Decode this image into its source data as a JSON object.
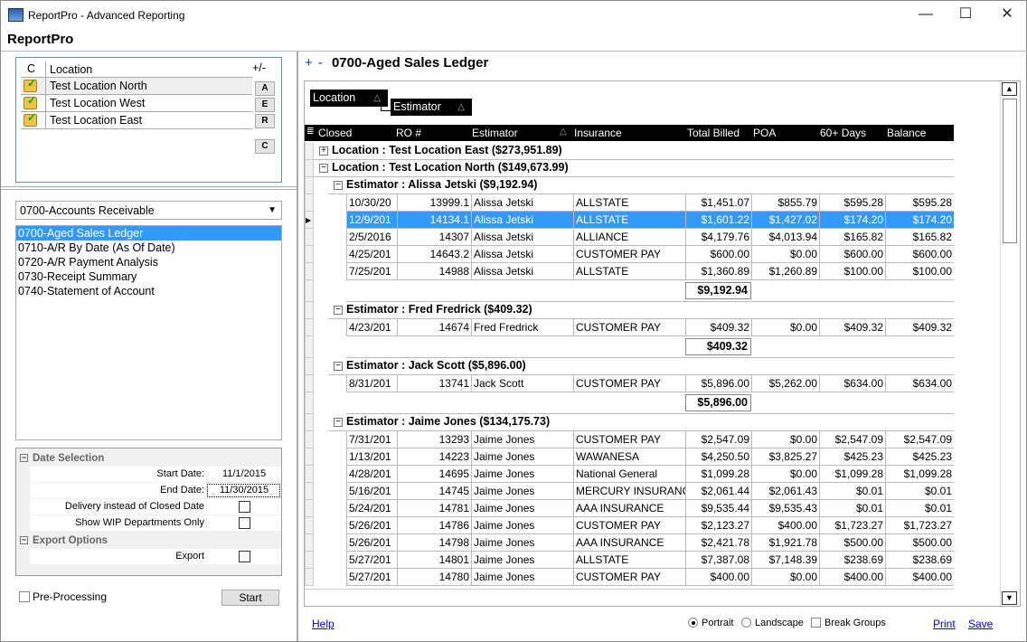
{
  "window": {
    "title": "ReportPro - Advanced Reporting",
    "app_title": "ReportPro",
    "minimize": "—",
    "maximize": "☐",
    "close": "✕"
  },
  "locations": {
    "header_c": "C",
    "header_location": "Location",
    "header_plusminus": "+/-",
    "items": [
      "Test Location North",
      "Test Location West",
      "Test Location East"
    ],
    "buttons": [
      "A",
      "E",
      "R",
      "C"
    ]
  },
  "report_category": "0700-Accounts Receivable",
  "reports": [
    "0700-Aged Sales Ledger",
    "0710-A/R By Date (As Of Date)",
    "0720-A/R Payment Analysis",
    "0730-Receipt Summary",
    "0740-Statement of Account"
  ],
  "selected_report_index": 0,
  "properties": {
    "date_selection": "Date Selection",
    "start_date_label": "Start Date:",
    "start_date": "11/1/2015",
    "end_date_label": "End Date:",
    "end_date": "11/30/2015",
    "delivery_label": "Delivery instead of Closed Date",
    "wip_label": "Show WIP Departments Only",
    "export_options": "Export Options",
    "export_label": "Export"
  },
  "pre_processing": "Pre-Processing",
  "start": "Start",
  "report": {
    "plus": "+",
    "minus": "-",
    "title": "0700-Aged Sales Ledger",
    "group_by": [
      "Location",
      "Estimator"
    ],
    "columns": [
      "Closed",
      "RO #",
      "Estimator",
      "Insurance",
      "Total Billed",
      "POA",
      "60+ Days",
      "Balance"
    ],
    "sorted_column": "Estimator",
    "groups": [
      {
        "label": "Location : Test Location East ($273,951.89)",
        "expanded": false
      },
      {
        "label": "Location : Test Location North ($149,673.99)",
        "expanded": true,
        "estimators": [
          {
            "label": "Estimator : Alissa Jetski ($9,192.94)",
            "subtotal": "$9,192.94",
            "rows": [
              [
                "10/30/20",
                "13999.1",
                "Alissa Jetski",
                "ALLSTATE",
                "$1,451.07",
                "$855.79",
                "$595.28",
                "$595.28"
              ],
              [
                "12/9/201",
                "14134.1",
                "Alissa Jetski",
                "ALLSTATE",
                "$1,601.22",
                "$1,427.02",
                "$174.20",
                "$174.20"
              ],
              [
                "2/5/2016",
                "14307",
                "Alissa Jetski",
                "ALLIANCE",
                "$4,179.76",
                "$4,013.94",
                "$165.82",
                "$165.82"
              ],
              [
                "4/25/201",
                "14643.2",
                "Alissa Jetski",
                "CUSTOMER PAY",
                "$600.00",
                "$0.00",
                "$600.00",
                "$600.00"
              ],
              [
                "7/25/201",
                "14988",
                "Alissa Jetski",
                "ALLSTATE",
                "$1,360.89",
                "$1,260.89",
                "$100.00",
                "$100.00"
              ]
            ],
            "selected_row": 1
          },
          {
            "label": "Estimator : Fred Fredrick ($409.32)",
            "subtotal": "$409.32",
            "rows": [
              [
                "4/23/201",
                "14674",
                "Fred Fredrick",
                "CUSTOMER PAY",
                "$409.32",
                "$0.00",
                "$409.32",
                "$409.32"
              ]
            ]
          },
          {
            "label": "Estimator : Jack Scott ($5,896.00)",
            "subtotal": "$5,896.00",
            "rows": [
              [
                "8/31/201",
                "13741",
                "Jack Scott",
                "CUSTOMER PAY",
                "$5,896.00",
                "$5,262.00",
                "$634.00",
                "$634.00"
              ]
            ]
          },
          {
            "label": "Estimator : Jaime Jones ($134,175.73)",
            "rows": [
              [
                "7/31/201",
                "13293",
                "Jaime Jones",
                "CUSTOMER PAY",
                "$2,547.09",
                "$0.00",
                "$2,547.09",
                "$2,547.09"
              ],
              [
                "1/13/201",
                "14223",
                "Jaime Jones",
                "WAWANESA",
                "$4,250.50",
                "$3,825.27",
                "$425.23",
                "$425.23"
              ],
              [
                "4/28/201",
                "14695",
                "Jaime Jones",
                "National General",
                "$1,099.28",
                "$0.00",
                "$1,099.28",
                "$1,099.28"
              ],
              [
                "5/16/201",
                "14745",
                "Jaime Jones",
                "MERCURY INSURANCE",
                "$2,061.44",
                "$2,061.43",
                "$0.01",
                "$0.01"
              ],
              [
                "5/24/201",
                "14781",
                "Jaime Jones",
                "AAA INSURANCE",
                "$9,535.44",
                "$9,535.43",
                "$0.01",
                "$0.01"
              ],
              [
                "5/26/201",
                "14786",
                "Jaime Jones",
                "CUSTOMER PAY",
                "$2,123.27",
                "$400.00",
                "$1,723.27",
                "$1,723.27"
              ],
              [
                "5/26/201",
                "14798",
                "Jaime Jones",
                "AAA INSURANCE",
                "$2,421.78",
                "$1,921.78",
                "$500.00",
                "$500.00"
              ],
              [
                "5/27/201",
                "14801",
                "Jaime Jones",
                "ALLSTATE",
                "$7,387.08",
                "$7,148.39",
                "$238.69",
                "$238.69"
              ],
              [
                "5/27/201",
                "14780",
                "Jaime Jones",
                "CUSTOMER PAY",
                "$400.00",
                "$0.00",
                "$400.00",
                "$400.00"
              ]
            ]
          }
        ]
      }
    ]
  },
  "footer": {
    "help": "Help",
    "portrait": "Portrait",
    "landscape": "Landscape",
    "break_groups": "Break Groups",
    "print": "Print",
    "save": "Save",
    "orientation": "Portrait"
  },
  "colors": {
    "selection": "#3399ff",
    "header_bg": "#000000",
    "link": "#0000ee",
    "focus_border": "#3c9be6"
  }
}
